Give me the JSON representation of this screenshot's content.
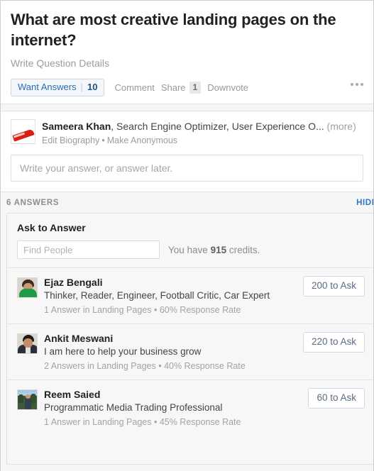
{
  "question": {
    "title": "What are most creative landing pages on the internet?",
    "details_placeholder": "Write Question Details",
    "want_answers_label": "Want Answers",
    "want_answers_count": "10",
    "divider": "|",
    "comment_label": "Comment",
    "share_label": "Share",
    "share_count": "1",
    "downvote_label": "Downvote",
    "more_menu_icon": "ellipsis-icon"
  },
  "composer": {
    "avatar_icon": "user-avatar-swoosh",
    "user_name": "Sameera Khan",
    "credentials": ", Search Engine Optimizer, User Experience O...",
    "more_label": "(more)",
    "edit_biography_label": "Edit Biography",
    "separator": "•",
    "make_anonymous_label": "Make Anonymous",
    "answer_placeholder": "Write your answer, or answer later."
  },
  "answers_bar": {
    "count_label": "6 ANSWERS",
    "hide_label": "HIDE"
  },
  "ask_panel": {
    "title": "Ask to Answer",
    "find_people_placeholder": "Find People",
    "credits_prefix": "You have ",
    "credits_value": "915",
    "credits_suffix": " credits.",
    "people": [
      {
        "avatar_icon": "avatar-ejaz-bengali",
        "name": "Ejaz Bengali",
        "bio": "Thinker, Reader, Engineer, Football Critic, Car Expert",
        "meta": "1 Answer in Landing Pages • 60% Response Rate",
        "ask_button_label": "200 to Ask"
      },
      {
        "avatar_icon": "avatar-ankit-meswani",
        "name": "Ankit Meswani",
        "bio": "I am here to help your business grow",
        "meta": "2 Answers in Landing Pages • 40% Response Rate",
        "ask_button_label": "220 to Ask"
      },
      {
        "avatar_icon": "avatar-reem-saied",
        "name": "Reem Saied",
        "bio": "Programmatic Media Trading Professional",
        "meta": "1 Answer in Landing Pages • 45% Response Rate",
        "ask_button_label": "60 to Ask"
      }
    ]
  },
  "colors": {
    "accent_blue": "#2b6dad",
    "link_blue": "#2b76c9",
    "page_bg": "#f6f6f6",
    "card_bg": "#ffffff",
    "panel_bg": "#f7f7f7",
    "muted_text": "#9c9c9c",
    "avatar_red": "#d81f12"
  }
}
